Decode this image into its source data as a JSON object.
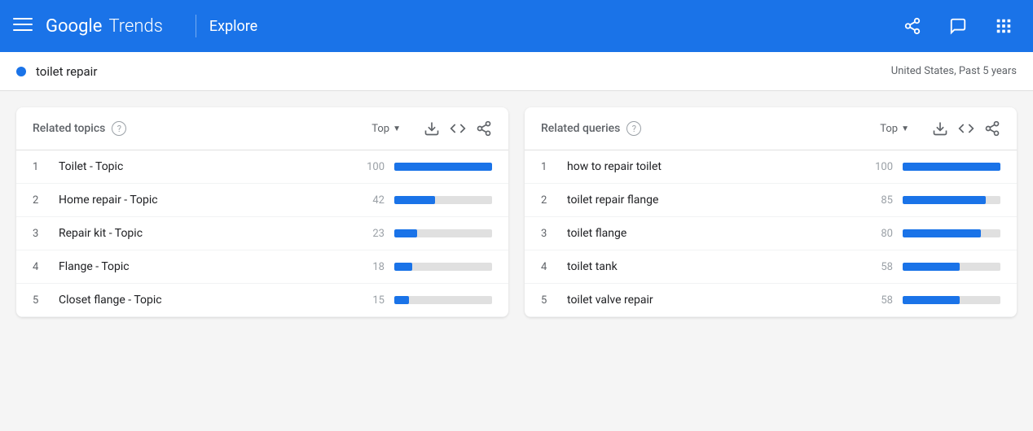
{
  "header": {
    "logo_google": "Google",
    "logo_trends": "Trends",
    "explore_label": "Explore"
  },
  "search_bar": {
    "term": "toilet repair",
    "meta": "United States, Past 5 years"
  },
  "left_card": {
    "title": "Related topics",
    "top_label": "Top",
    "rows": [
      {
        "num": "1",
        "label": "Toilet - Topic",
        "value": "100",
        "pct": 100
      },
      {
        "num": "2",
        "label": "Home repair - Topic",
        "value": "42",
        "pct": 42
      },
      {
        "num": "3",
        "label": "Repair kit - Topic",
        "value": "23",
        "pct": 23
      },
      {
        "num": "4",
        "label": "Flange - Topic",
        "value": "18",
        "pct": 18
      },
      {
        "num": "5",
        "label": "Closet flange - Topic",
        "value": "15",
        "pct": 15
      }
    ]
  },
  "right_card": {
    "title": "Related queries",
    "top_label": "Top",
    "rows": [
      {
        "num": "1",
        "label": "how to repair toilet",
        "value": "100",
        "pct": 100
      },
      {
        "num": "2",
        "label": "toilet repair flange",
        "value": "85",
        "pct": 85
      },
      {
        "num": "3",
        "label": "toilet flange",
        "value": "80",
        "pct": 80
      },
      {
        "num": "4",
        "label": "toilet tank",
        "value": "58",
        "pct": 58
      },
      {
        "num": "5",
        "label": "toilet valve repair",
        "value": "58",
        "pct": 58
      }
    ]
  }
}
